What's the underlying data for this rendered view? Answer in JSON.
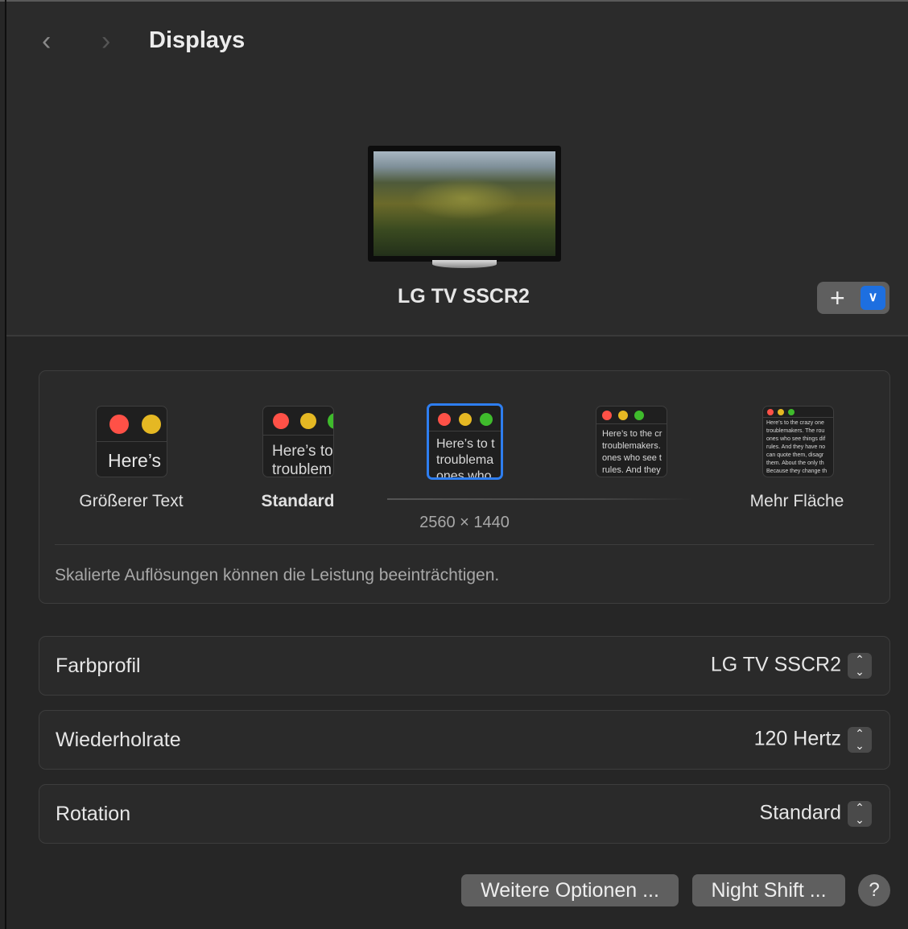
{
  "header": {
    "title": "Displays",
    "back": "‹",
    "forward": "›"
  },
  "display": {
    "name": "LG TV SSCR2",
    "add": "+",
    "menu": "⌄"
  },
  "scaling": {
    "options": [
      {
        "label": "Größerer Text",
        "preview": "Here’s"
      },
      {
        "label": "Standard",
        "preview": "Here’s to\ntroublem"
      },
      {
        "label": "",
        "preview": "Here’s to t\ntroublema\nones who"
      },
      {
        "label": "",
        "preview": "Here’s to the cr\ntroublemakers.\nones who see t\nrules. And they"
      },
      {
        "label": "Mehr Fläche",
        "preview": "Here’s to the crazy one\ntroublemakers. The rou\nones who see things dif\nrules. And they have no\ncan quote them, disagr\nthem. About the only th\nBecause they change th"
      }
    ],
    "resolution": "2560 × 1440",
    "note": "Skalierte Auflösungen können die Leistung beeinträchtigen."
  },
  "settings": [
    {
      "label": "Farbprofil",
      "value": "LG TV SSCR2"
    },
    {
      "label": "Wiederholrate",
      "value": "120 Hertz"
    },
    {
      "label": "Rotation",
      "value": "Standard"
    }
  ],
  "buttons": {
    "more": "Weitere Optionen ...",
    "night": "Night Shift ...",
    "help": "?"
  },
  "colors": {
    "accent": "#1d6fe0",
    "red": "#ff5147",
    "yellow": "#e5b823",
    "green": "#3fbb2c"
  }
}
